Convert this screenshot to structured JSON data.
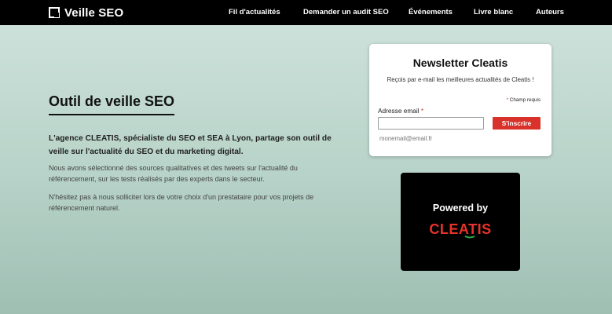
{
  "header": {
    "logo_text": "Veille SEO",
    "logo_icon": "square-logo-icon",
    "nav": [
      {
        "label": "Fil d'actualités"
      },
      {
        "label": "Demander un audit SEO"
      },
      {
        "label": "Événements"
      },
      {
        "label": "Livre blanc"
      },
      {
        "label": "Auteurs"
      }
    ]
  },
  "main": {
    "title": "Outil de veille SEO",
    "lead": "L'agence CLEATIS, spécialiste du SEO et SEA à Lyon, partage son outil de veille sur l'actualité du SEO et du marketing digital.",
    "paragraph1": "Nous avons sélectionné des sources qualitatives et des tweets sur l'actualité du référencement, sur les tests réalisés par des experts dans le secteur.",
    "paragraph2": "N'hésitez pas à nous solliciter lors de votre choix d'un prestataire pour vos projets de référencement naturel."
  },
  "newsletter": {
    "title": "Newsletter Cleatis",
    "description": "Reçois par e-mail les meilleures actualités de Cleatis !",
    "required_star": "*",
    "required_label": "Champ requis",
    "email_label": "Adresse email",
    "email_value": "",
    "submit_label": "S'inscrire",
    "hint": "monemail@email.fr"
  },
  "powered": {
    "label": "Powered by",
    "brand": "CLEATIS",
    "brand_color": "#e8332a",
    "accent_color": "#2aa84a"
  },
  "colors": {
    "topbar": "#000000",
    "button": "#d9322a"
  }
}
